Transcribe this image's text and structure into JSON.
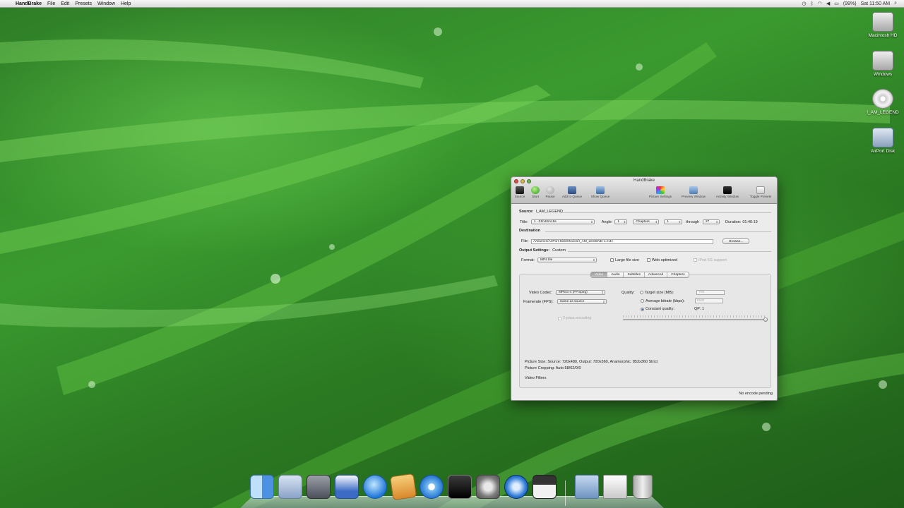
{
  "menubar": {
    "app_name": "HandBrake",
    "items": [
      "File",
      "Edit",
      "Presets",
      "Window",
      "Help"
    ],
    "battery": "(99%)",
    "clock": "Sat 11:50 AM"
  },
  "desktop": {
    "icons": [
      "Macintosh HD",
      "Windows",
      "I_AM_LEGEND",
      "AirPort Disk"
    ]
  },
  "window": {
    "title": "HandBrake",
    "toolbar": {
      "source": "Source",
      "start": "Start",
      "pause": "Pause",
      "add_to_queue": "Add to Queue",
      "show_queue": "Show Queue",
      "picture_settings": "Picture Settings",
      "preview_window": "Preview Window",
      "activity_window": "Activity Window",
      "toggle_presets": "Toggle Presets"
    },
    "source": {
      "label": "Source:",
      "value": "I_AM_LEGEND"
    },
    "title_row": {
      "title_label": "Title:",
      "title_value": "1 - 01h40m19s",
      "angle_label": "Angle:",
      "angle_value": "1",
      "chapters_value": "Chapters",
      "start_chapter": "1",
      "through_label": "through",
      "end_chapter": "27",
      "duration_label": "Duration:",
      "duration_value": "01:40:19"
    },
    "destination": {
      "heading": "Destination",
      "file_label": "File:",
      "file_path": "/Volumes/AirPort Disk/Movies/I_AM_LEGEND-1.m4v",
      "browse_label": "Browse..."
    },
    "output": {
      "heading": "Output Settings:",
      "preset": "Custom",
      "format_label": "Format:",
      "format_value": "MP4 file",
      "large_file": "Large file size",
      "web_optimized": "Web optimized",
      "ipod": "iPod 5G support"
    },
    "tabs": [
      "Video",
      "Audio",
      "Subtitles",
      "Advanced",
      "Chapters"
    ],
    "video": {
      "codec_label": "Video Codec:",
      "codec_value": "MPEG-4 (FFmpeg)",
      "framerate_label": "Framerate (FPS):",
      "framerate_value": "Same as source",
      "two_pass": "2-pass encoding",
      "quality_label": "Quality:",
      "target_size": "Target size (MB):",
      "target_size_value": "700",
      "avg_bitrate": "Average bitrate (kbps):",
      "avg_bitrate_value": "1500",
      "constant_quality": "Constant quality:",
      "qp_label": "QP: 1",
      "quality_level": 1.0
    },
    "picture_info": {
      "size": "Picture Size: Source: 720x480, Output: 720x360, Anamorphic: 853x360 Strict",
      "cropping": "Picture Cropping: Auto 58/62/0/0",
      "filters": "Video Filters"
    },
    "status": "No encode pending"
  },
  "colors": {
    "accent_blue": "#1a57c9",
    "start_green": "#2f9a1a",
    "wallpaper_green": "#3a9a2f"
  },
  "dock": {
    "items": [
      "finder-icon",
      "mail-icon",
      "script-editor-icon",
      "todo-icon",
      "itunes-icon",
      "package-icon",
      "safari-icon",
      "terminal-icon",
      "system-preferences-icon",
      "time-machine-icon",
      "handbrake-icon",
      "applications-folder-icon",
      "documents-stack-icon",
      "trash-icon"
    ]
  }
}
